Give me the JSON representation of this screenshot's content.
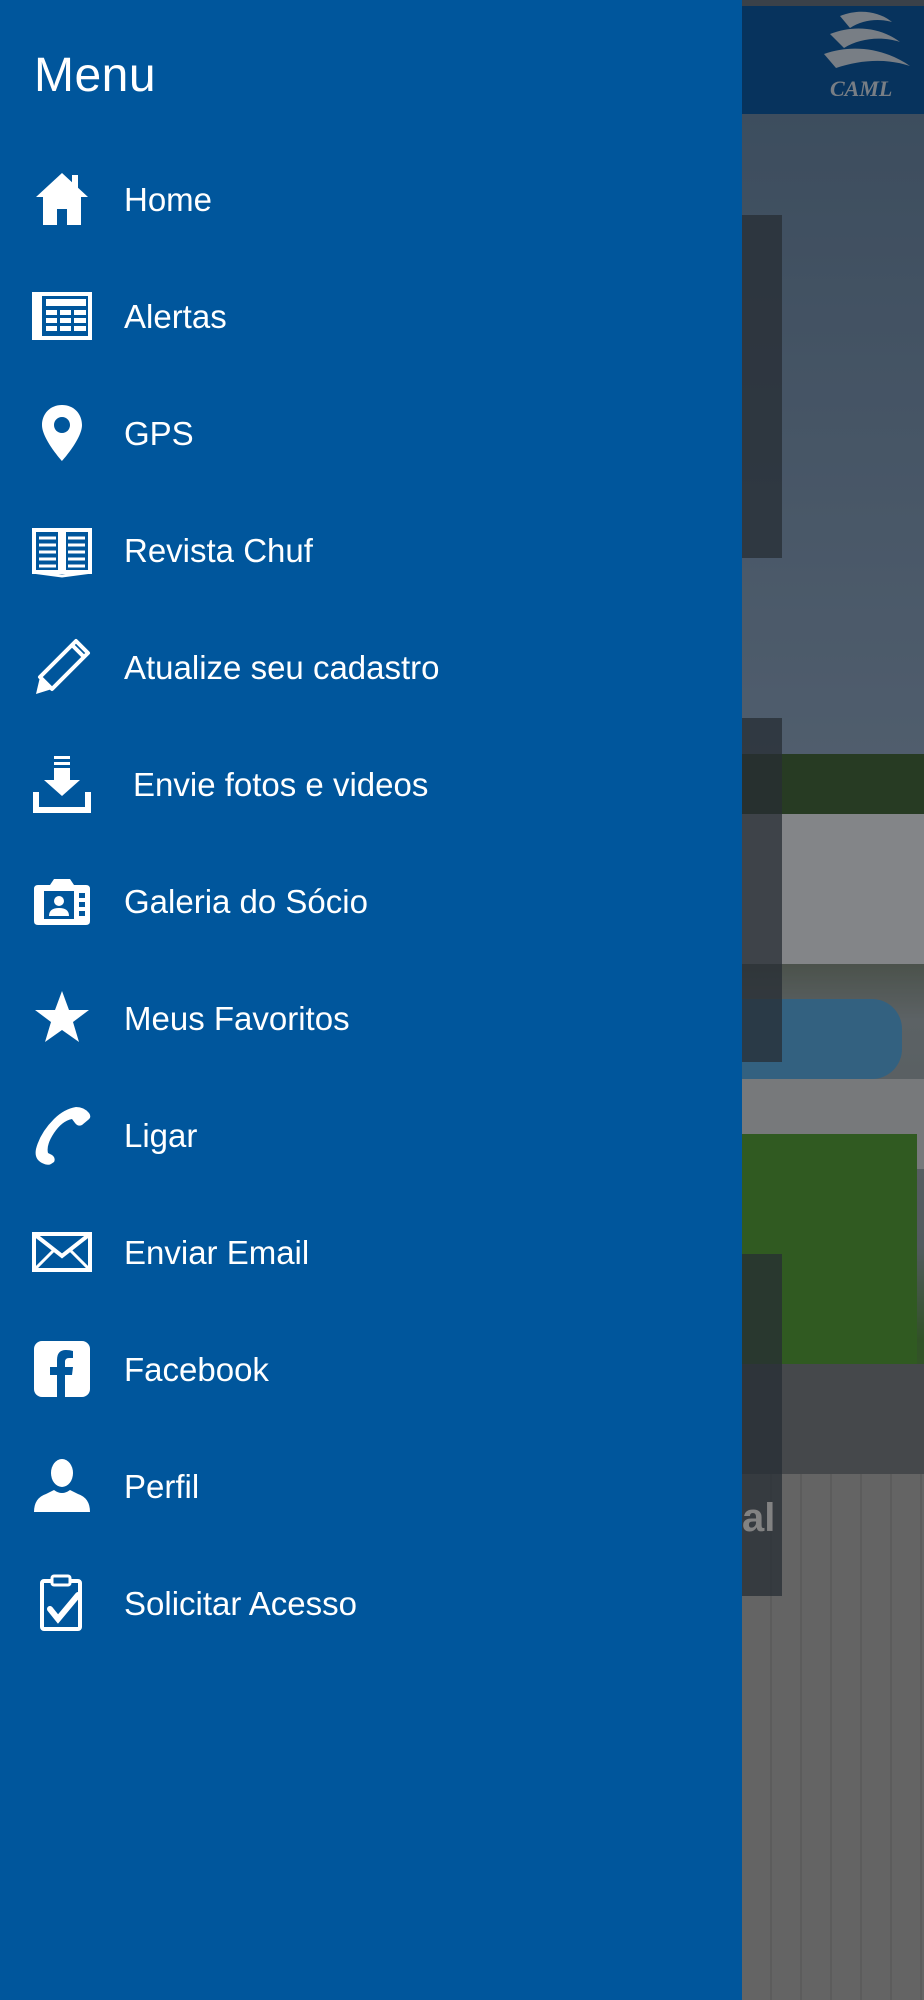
{
  "drawer": {
    "title": "Menu",
    "items": [
      {
        "label": "Home",
        "icon": "home-icon"
      },
      {
        "label": "Alertas",
        "icon": "newspaper-icon"
      },
      {
        "label": "GPS",
        "icon": "map-pin-icon"
      },
      {
        "label": "Revista Chuf",
        "icon": "open-book-icon"
      },
      {
        "label": "Atualize seu cadastro",
        "icon": "pencil-icon"
      },
      {
        "label": " Envie fotos e videos",
        "icon": "download-icon"
      },
      {
        "label": "Galeria do Sócio",
        "icon": "camera-portrait-icon"
      },
      {
        "label": "Meus Favoritos",
        "icon": "star-icon"
      },
      {
        "label": "Ligar",
        "icon": "phone-icon"
      },
      {
        "label": "Enviar Email",
        "icon": "envelope-icon"
      },
      {
        "label": "Facebook",
        "icon": "facebook-icon"
      },
      {
        "label": "Perfil",
        "icon": "user-icon"
      },
      {
        "label": "Solicitar Acesso",
        "icon": "clipboard-check-icon"
      }
    ]
  },
  "background": {
    "logo_text": "CAML",
    "partial_text": "al"
  },
  "colors": {
    "drawer_background": "#00569c",
    "header_background": "#0b4f8f",
    "text": "#ffffff"
  }
}
